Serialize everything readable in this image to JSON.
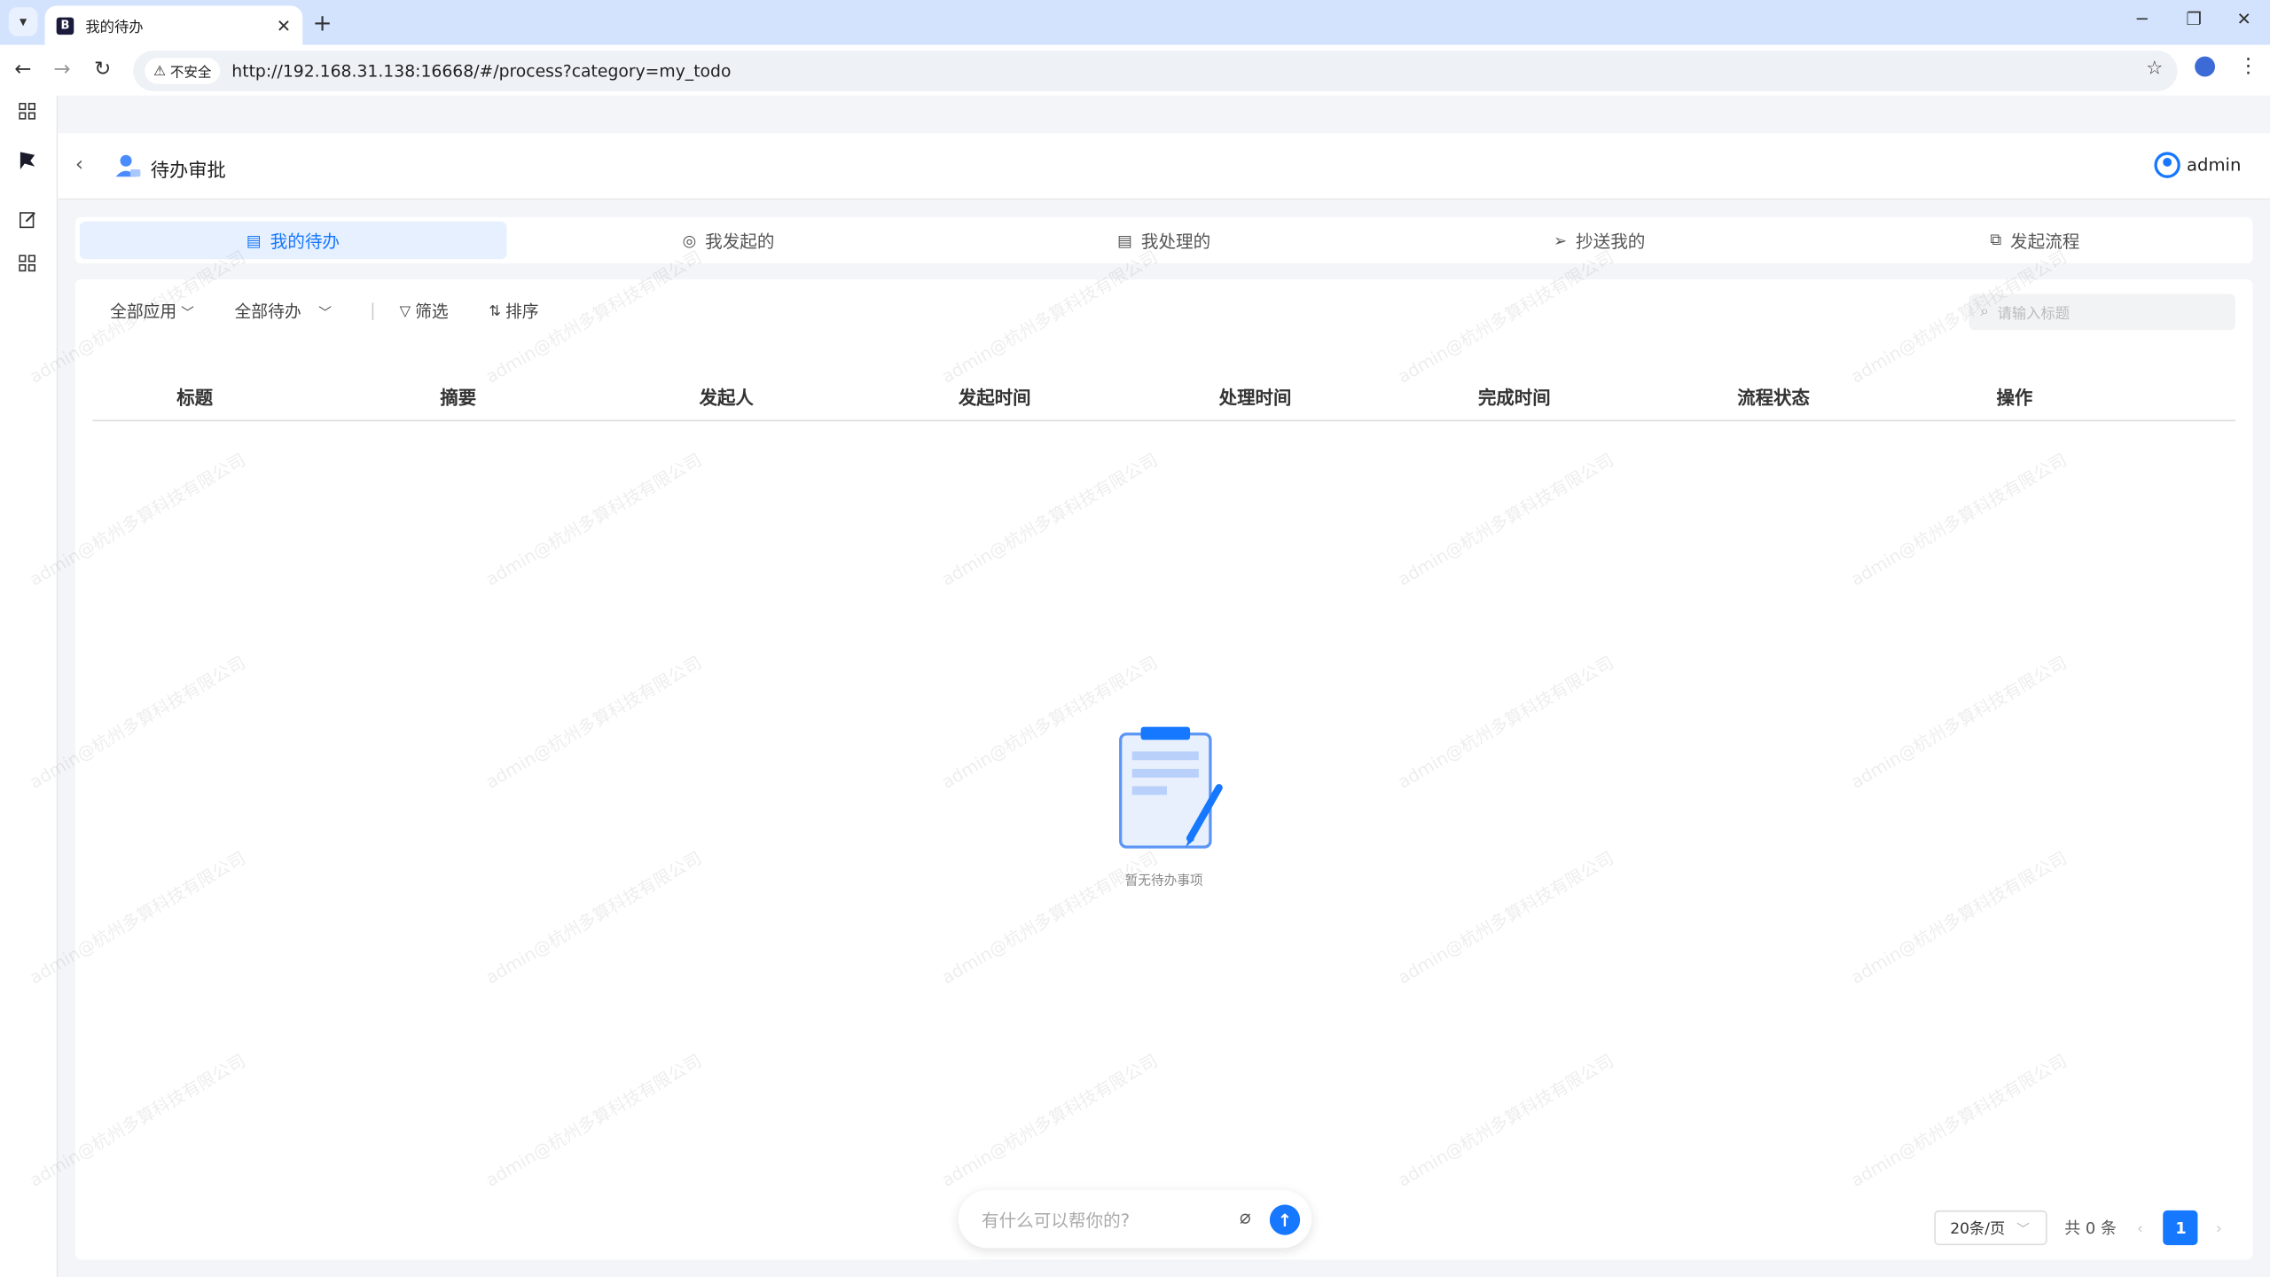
{
  "browser": {
    "tab_title": "我的待办",
    "new_tab": "+",
    "security_chip": "不安全",
    "url": "http://192.168.31.138:16668/#/process?category=my_todo"
  },
  "header": {
    "title": "待办审批",
    "user_name": "admin"
  },
  "tabs": [
    {
      "label": "我的待办",
      "icon": "todo-icon",
      "active": true
    },
    {
      "label": "我发起的",
      "icon": "initiated-icon",
      "active": false
    },
    {
      "label": "我处理的",
      "icon": "handled-icon",
      "active": false
    },
    {
      "label": "抄送我的",
      "icon": "cc-icon",
      "active": false
    },
    {
      "label": "发起流程",
      "icon": "start-process-icon",
      "active": false
    }
  ],
  "toolbar": {
    "app_filter": "全部应用",
    "todo_filter": "全部待办",
    "filter_label": "筛选",
    "sort_label": "排序",
    "search_placeholder": "请输入标题"
  },
  "table": {
    "columns": [
      "标题",
      "摘要",
      "发起人",
      "发起时间",
      "处理时间",
      "完成时间",
      "流程状态",
      "操作"
    ],
    "rows": []
  },
  "empty_text": "暂无待办事项",
  "chat": {
    "placeholder": "有什么可以帮你的?"
  },
  "pagination": {
    "page_size": "20条/页",
    "total": "共 0 条",
    "current_page": "1"
  },
  "watermark": "admin@杭州多算科技有限公司",
  "colors": {
    "accent": "#1677ff",
    "active_tab_bg": "#e6f0ff"
  }
}
